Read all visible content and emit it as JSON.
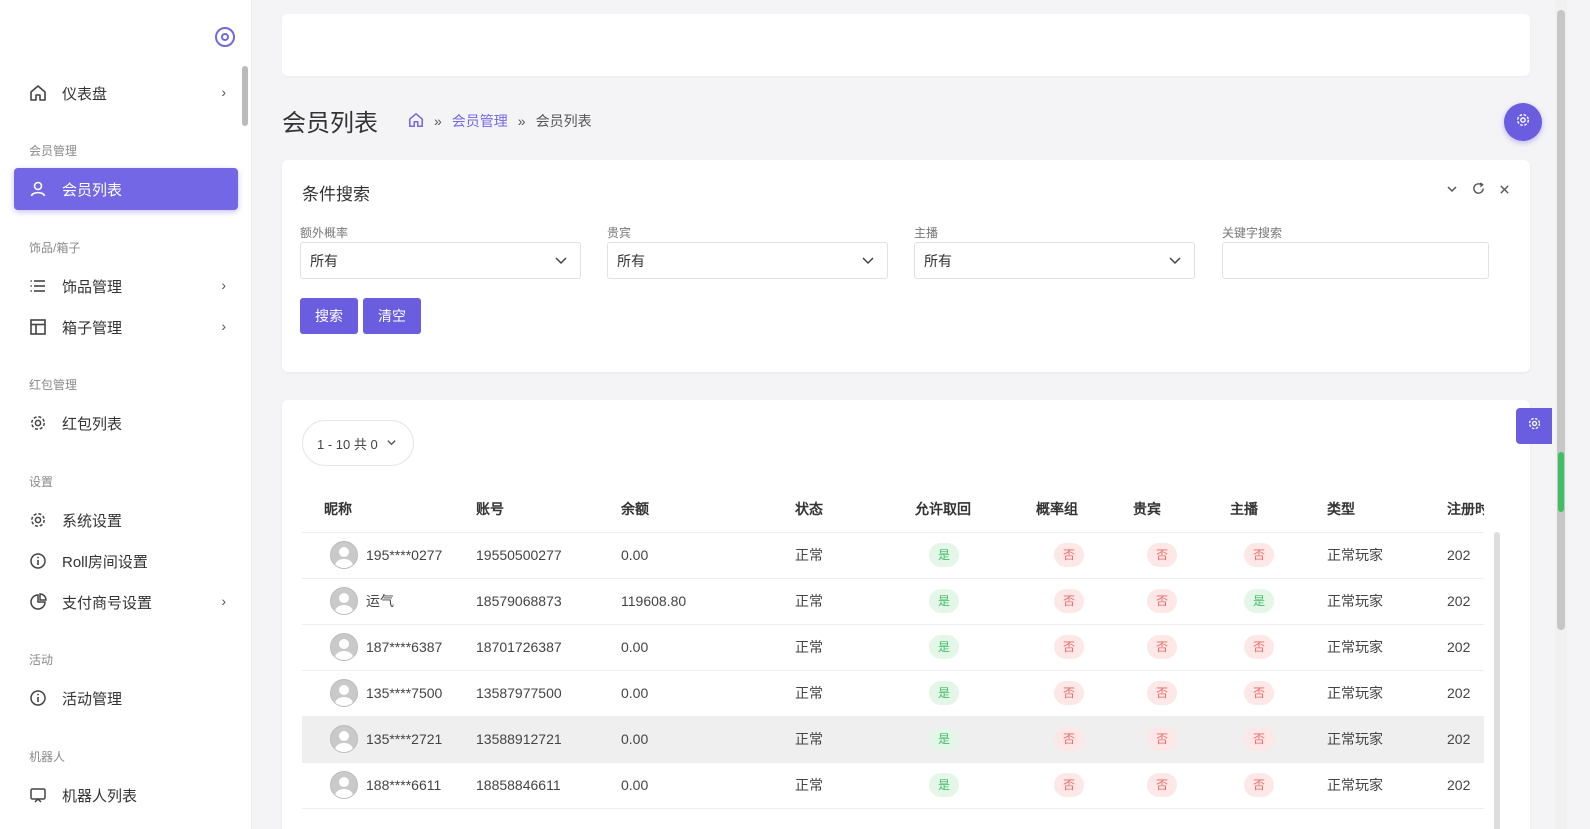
{
  "sidebar": {
    "items": [
      {
        "label": "仪表盘"
      },
      {
        "label": "会员列表"
      },
      {
        "label": "饰品管理"
      },
      {
        "label": "箱子管理"
      },
      {
        "label": "红包列表"
      },
      {
        "label": "系统设置"
      },
      {
        "label": "Roll房间设置"
      },
      {
        "label": "支付商号设置"
      },
      {
        "label": "活动管理"
      },
      {
        "label": "机器人列表"
      }
    ],
    "sections": [
      "会员管理",
      "饰品/箱子",
      "红包管理",
      "设置",
      "活动",
      "机器人"
    ]
  },
  "header": {
    "title": "会员列表",
    "breadcrumb": [
      "会员管理",
      "会员列表"
    ],
    "sep": "»"
  },
  "search": {
    "title": "条件搜索",
    "fields": [
      {
        "label": "额外概率",
        "value": "所有"
      },
      {
        "label": "贵宾",
        "value": "所有"
      },
      {
        "label": "主播",
        "value": "所有"
      },
      {
        "label": "关键字搜索",
        "value": ""
      }
    ],
    "search_btn": "搜索",
    "clear_btn": "清空"
  },
  "table": {
    "pager": "1 - 10 共 0",
    "columns": [
      "昵称",
      "账号",
      "余额",
      "状态",
      "允许取回",
      "概率组",
      "贵宾",
      "主播",
      "类型",
      "注册时"
    ],
    "rows": [
      {
        "nick": "195****0277",
        "account": "19550500277",
        "balance": "0.00",
        "status": "正常",
        "retrieve": "是",
        "prob": "否",
        "vip": "否",
        "anchor": "否",
        "type": "正常玩家",
        "reg": "202"
      },
      {
        "nick": "运气",
        "account": "18579068873",
        "balance": "119608.80",
        "status": "正常",
        "retrieve": "是",
        "prob": "否",
        "vip": "否",
        "anchor": "是",
        "type": "正常玩家",
        "reg": "202"
      },
      {
        "nick": "187****6387",
        "account": "18701726387",
        "balance": "0.00",
        "status": "正常",
        "retrieve": "是",
        "prob": "否",
        "vip": "否",
        "anchor": "否",
        "type": "正常玩家",
        "reg": "202"
      },
      {
        "nick": "135****7500",
        "account": "13587977500",
        "balance": "0.00",
        "status": "正常",
        "retrieve": "是",
        "prob": "否",
        "vip": "否",
        "anchor": "否",
        "type": "正常玩家",
        "reg": "202"
      },
      {
        "nick": "135****2721",
        "account": "13588912721",
        "balance": "0.00",
        "status": "正常",
        "retrieve": "是",
        "prob": "否",
        "vip": "否",
        "anchor": "否",
        "type": "正常玩家",
        "reg": "202"
      },
      {
        "nick": "188****6611",
        "account": "18858846611",
        "balance": "0.00",
        "status": "正常",
        "retrieve": "是",
        "prob": "否",
        "vip": "否",
        "anchor": "否",
        "type": "正常玩家",
        "reg": "202"
      }
    ]
  },
  "colors": {
    "accent": "#6a5de0",
    "yes": "#3fbf62",
    "no": "#e96a6a"
  }
}
